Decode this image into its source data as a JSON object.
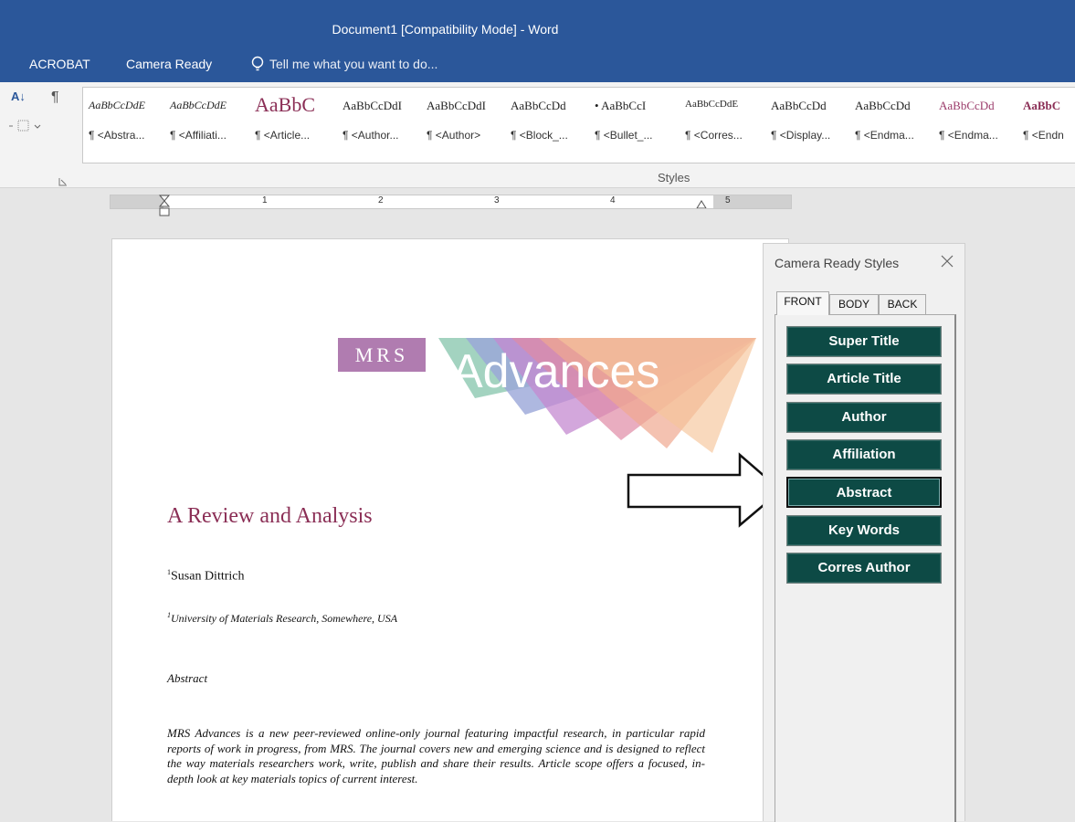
{
  "titlebar": {
    "document_title": "Document1 [Compatibility Mode] - Word",
    "menu": [
      "ACROBAT",
      "Camera Ready"
    ],
    "tellme_placeholder": "Tell me what you want to do..."
  },
  "ribbon": {
    "sort_label": "A↓",
    "pilcrow_label": "¶",
    "styles_group_label": "Styles",
    "styles": [
      {
        "sample": "AaBbCcDdE",
        "label": "¶ <Abstra..."
      },
      {
        "sample": "AaBbCcDdE",
        "label": "¶ <Affiliati..."
      },
      {
        "sample": "AaBbC",
        "label": "¶ <Article..."
      },
      {
        "sample": "AaBbCcDdI",
        "label": "¶ <Author..."
      },
      {
        "sample": "AaBbCcDdI",
        "label": "¶ <Author>"
      },
      {
        "sample": "AaBbCcDd",
        "label": "¶ <Block_..."
      },
      {
        "sample": "• AaBbCcI",
        "label": "¶ <Bullet_..."
      },
      {
        "sample": "AaBbCcDdE",
        "label": "¶ <Corres..."
      },
      {
        "sample": "AaBbCcDd",
        "label": "¶ <Display..."
      },
      {
        "sample": "AaBbCcDd",
        "label": "¶ <Endma..."
      },
      {
        "sample": "AaBbCcDd",
        "label": "¶ <Endma..."
      },
      {
        "sample": "AaBbC",
        "label": "¶ <Endn"
      }
    ]
  },
  "ruler": {
    "numbers": [
      "1",
      "2",
      "3",
      "4",
      "5"
    ]
  },
  "document": {
    "logo_text_left": "MRS",
    "logo_text_right": "Advances",
    "heading": "A Review and Analysis",
    "author_sup": "1",
    "author": "Susan Dittrich",
    "affil_sup": "1",
    "affiliation": "University of Materials Research, Somewhere, USA",
    "abstract_heading": "Abstract",
    "abstract_body": "MRS Advances is a new peer-reviewed online-only journal featuring impactful research, in particular rapid reports of work in progress, from MRS. The journal covers new and emerging science and is designed to reflect the way materials researchers work, write, publish and share their results. Article scope offers a focused, in-depth look at key materials topics of current interest."
  },
  "panel": {
    "title": "Camera Ready Styles",
    "tabs": [
      "FRONT",
      "BODY",
      "BACK"
    ],
    "buttons": [
      "Super Title",
      "Article Title",
      "Author",
      "Affiliation",
      "Abstract",
      "Key Words",
      "Corres Author"
    ]
  },
  "colors": {
    "titlebar": "#2b579a",
    "heading": "#8b2f56",
    "style_button": "#0d4a45"
  }
}
